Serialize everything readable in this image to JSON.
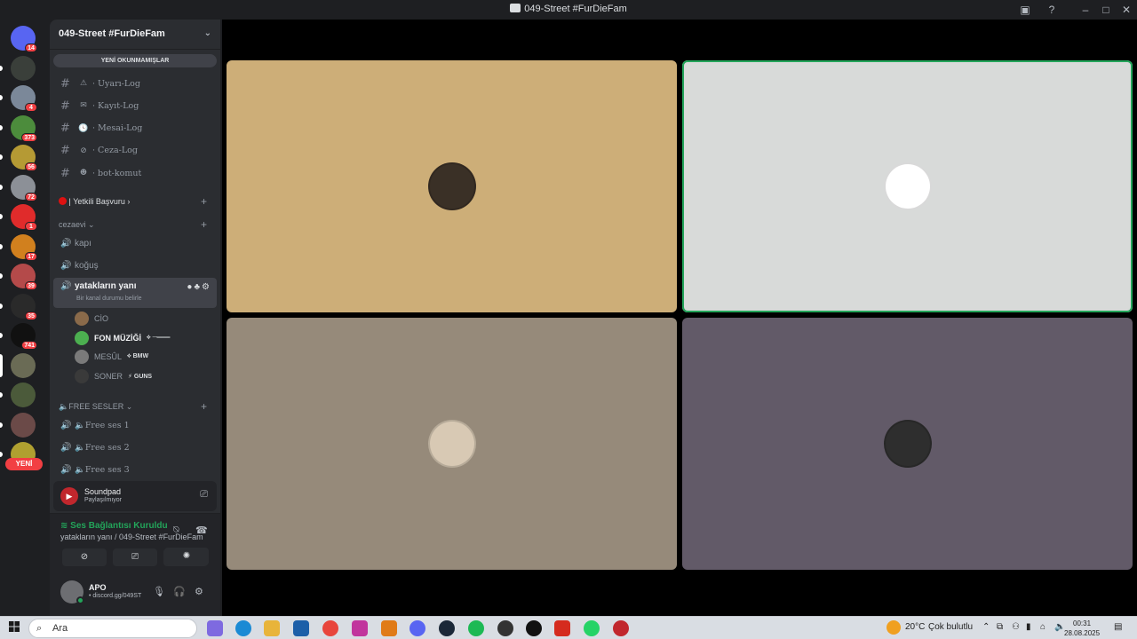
{
  "window": {
    "title": "049-Street #FurDieFam"
  },
  "rail": {
    "servers": [
      {
        "badge": "14",
        "color": "#5865f2"
      },
      {
        "badge": "",
        "color": "#3a3f3a"
      },
      {
        "badge": "4",
        "color": "#7b8899"
      },
      {
        "badge": "373",
        "color": "#4c8c3c"
      },
      {
        "badge": "56",
        "color": "#b59a34"
      },
      {
        "badge": "72",
        "color": "#8c9097"
      },
      {
        "badge": "1",
        "color": "#e02b2b"
      },
      {
        "badge": "17",
        "color": "#d1801e"
      },
      {
        "badge": "39",
        "color": "#b44a4a"
      },
      {
        "badge": "35",
        "color": "#2a2a2a"
      },
      {
        "badge": "741",
        "color": "#111111"
      },
      {
        "badge": "",
        "color": "#6a6b55"
      },
      {
        "badge": "",
        "color": "#4b5a3a"
      },
      {
        "badge": "",
        "color": "#6b4a48"
      },
      {
        "badge": "",
        "color": "#b0a030"
      }
    ],
    "new_label": "YENİ"
  },
  "sidebar": {
    "server_name": "049-Street #FurDieFam",
    "unread_label": "YENİ OKUNMAMIŞLAR",
    "text_channels": [
      {
        "emoji": "⚠",
        "name": "Uyarı-Log"
      },
      {
        "emoji": "✉",
        "name": "Kayıt-Log"
      },
      {
        "emoji": "🕓",
        "name": "Mesai-Log"
      },
      {
        "emoji": "⊘",
        "name": "Ceza-Log"
      },
      {
        "emoji": "☻",
        "name": "bot-komut"
      }
    ],
    "category_apply": "| Yetkili Başvuru",
    "category_jail": "cezaevi",
    "jail_channels": [
      "kapı",
      "koğuş"
    ],
    "active_channel": {
      "name": "yatakların yanı",
      "status": "Bir kanal durumu belirle"
    },
    "members": [
      {
        "name": "CİO",
        "tag": "",
        "color": "#8a6a4a",
        "bold": false
      },
      {
        "name": "FON MÜZİĞİ",
        "tag": "⟡ ─═══",
        "color": "#4caf50",
        "bold": true
      },
      {
        "name": "MESÛL",
        "tag": "⟡ BMW",
        "color": "#7a7a7a",
        "bold": false
      },
      {
        "name": "SONER",
        "tag": "⚡ GUNS",
        "color": "#3a3a3a",
        "bold": false
      }
    ],
    "category_free": "FREE SESLER",
    "free_channels": [
      "🔈Free ses 1",
      "🔈Free ses 2",
      "🔈Free ses 3"
    ]
  },
  "soundpad": {
    "name": "Soundpad",
    "status": "Paylaşılmıyor"
  },
  "voice": {
    "status": "Ses Bağlantısı Kuruldu",
    "location": "yatakların yanı / 049-Street #FurDieFam"
  },
  "user": {
    "name": "APO",
    "status": "• discord.gg/049ST"
  },
  "tiles": [
    {
      "bg": "#cdae78",
      "speaking": false,
      "avatar": "#3a3026"
    },
    {
      "bg": "#d8dad9",
      "speaking": true,
      "avatar": "#ffffff"
    },
    {
      "bg": "#968a7a",
      "speaking": false,
      "avatar": "#d8c9b4"
    },
    {
      "bg": "#625a68",
      "speaking": false,
      "avatar": "#2e2e2e"
    }
  ],
  "taskbar": {
    "search_placeholder": "Ara",
    "weather": "20°C",
    "weather_text": "Çok bulutlu",
    "time": "00:31",
    "date": "28.08.2025"
  }
}
